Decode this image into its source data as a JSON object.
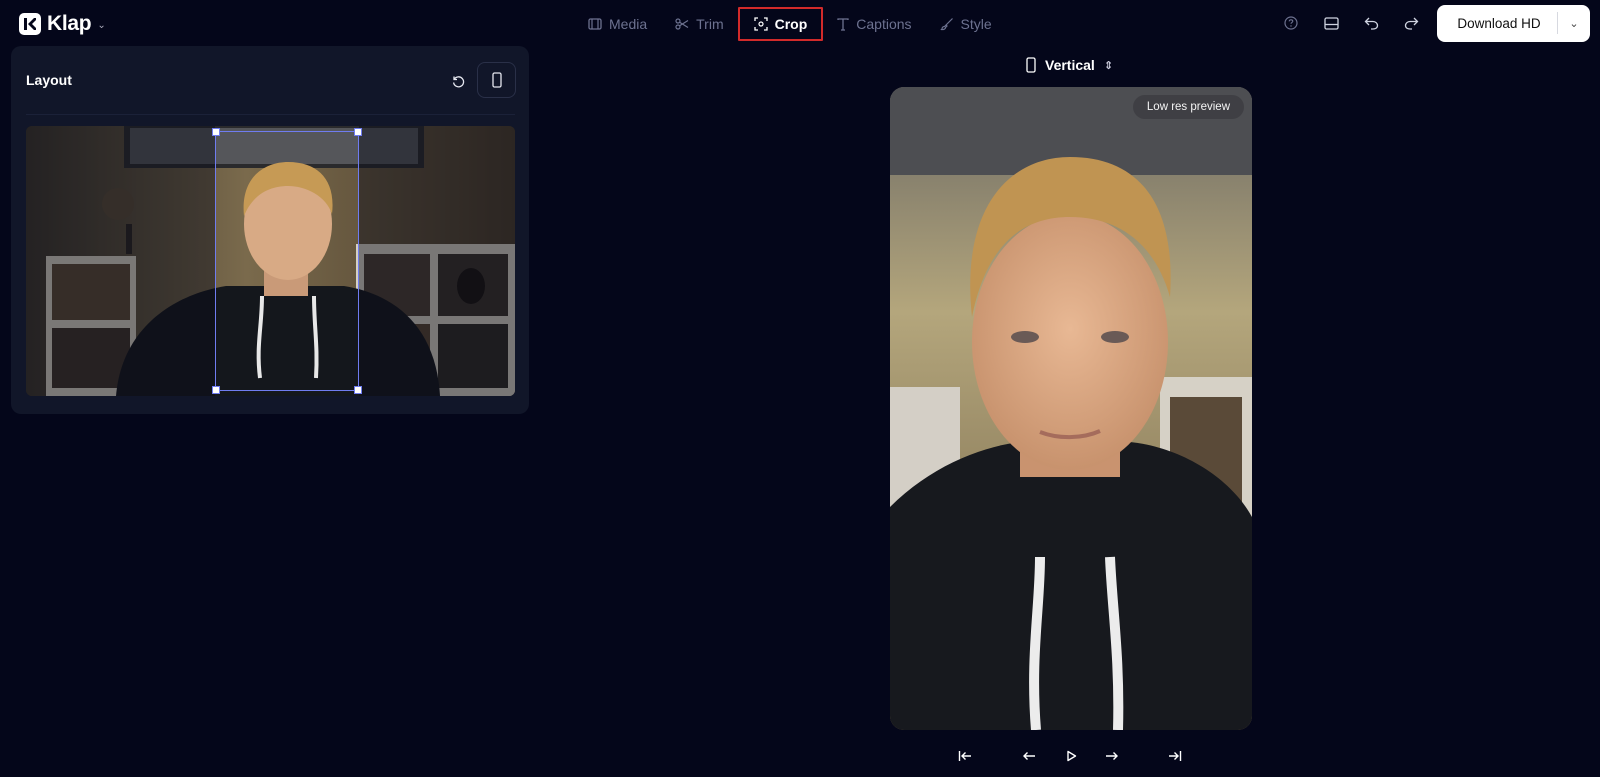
{
  "app": {
    "name": "Klap"
  },
  "tabs": [
    {
      "label": "Media",
      "icon": "film-icon",
      "active": false
    },
    {
      "label": "Trim",
      "icon": "scissors-icon",
      "active": false
    },
    {
      "label": "Crop",
      "icon": "crop-icon",
      "active": true
    },
    {
      "label": "Captions",
      "icon": "text-icon",
      "active": false
    },
    {
      "label": "Style",
      "icon": "brush-icon",
      "active": false
    }
  ],
  "toolbar": {
    "download_label": "Download HD",
    "icons": [
      "help-icon",
      "layout-toggle-icon",
      "undo-icon",
      "redo-icon"
    ]
  },
  "layout_panel": {
    "title": "Layout",
    "reset_icon": "reset-icon",
    "orientation_icon": "phone-icon"
  },
  "preview": {
    "aspect_label": "Vertical",
    "badge": "Low res preview"
  },
  "playback": {
    "icons": [
      "skip-to-start-icon",
      "step-back-icon",
      "play-icon",
      "step-forward-icon",
      "skip-to-end-icon"
    ]
  },
  "colors": {
    "background": "#04061a",
    "panel": "#111629",
    "active_tab_outline": "#d22a2a",
    "crop_outline": "#6f7cf0"
  }
}
